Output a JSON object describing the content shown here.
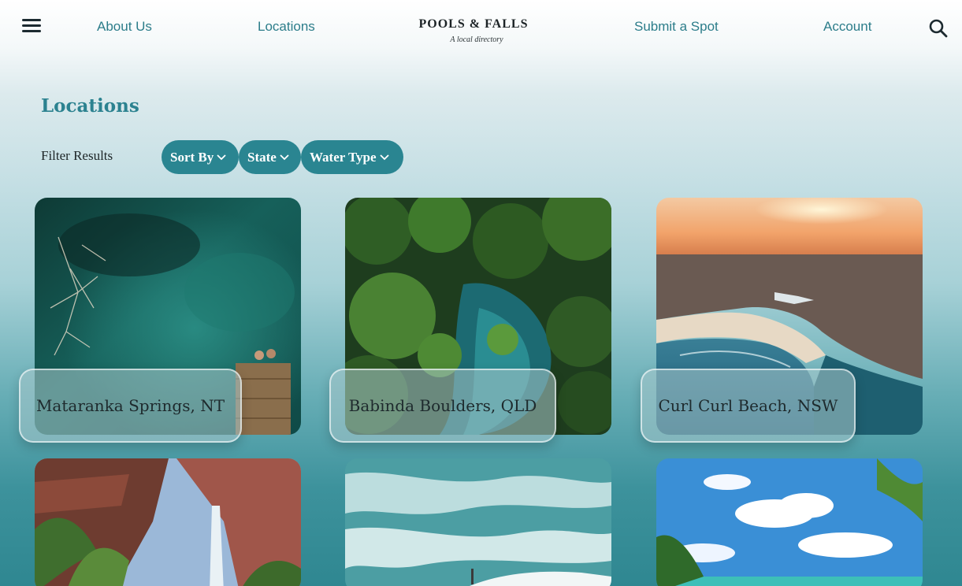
{
  "header": {
    "nav": {
      "about": "About Us",
      "locations": "Locations",
      "submit": "Submit a Spot",
      "account": "Account"
    },
    "logo": {
      "title": "POOLS & FALLS",
      "tagline": "A local directory"
    },
    "icons": {
      "menu": "hamburger-menu-icon",
      "search": "search-icon"
    }
  },
  "page": {
    "title": "Locations"
  },
  "filters": {
    "label": "Filter Results",
    "sort_by": "Sort By",
    "state": "State",
    "water_type": "Water Type"
  },
  "cards": [
    {
      "name": "Mataranka Springs, NT"
    },
    {
      "name": "Babinda Boulders, QLD"
    },
    {
      "name": "Curl Curl Beach, NSW"
    },
    {
      "name": ""
    },
    {
      "name": ""
    },
    {
      "name": ""
    }
  ],
  "colors": {
    "accent": "#2a8591",
    "nav_text": "#2c7d8a",
    "heading": "#2c8290"
  }
}
